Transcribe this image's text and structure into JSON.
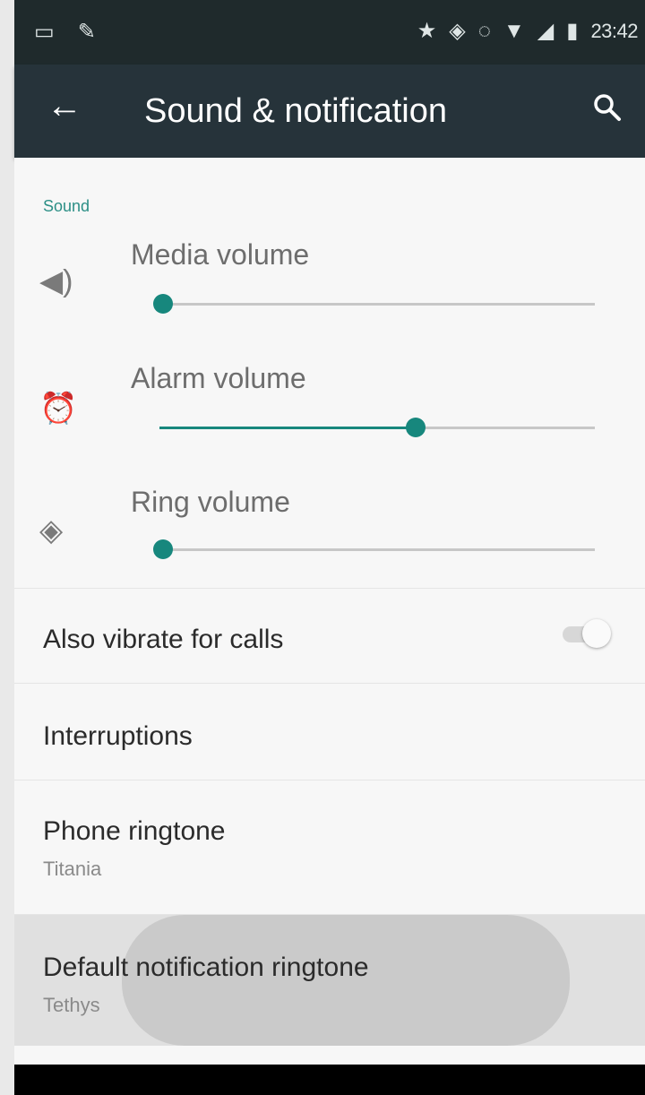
{
  "status_bar": {
    "left_icons": [
      "image-icon",
      "pen-icon"
    ],
    "right_icons": [
      "star-icon",
      "vibrate-icon",
      "alarm-icon",
      "wifi-icon",
      "signal-icon",
      "battery-icon"
    ],
    "time": "23:42"
  },
  "app_bar": {
    "title": "Sound & notification",
    "back_icon": "arrow-back-icon",
    "search_icon": "search-icon"
  },
  "colors": {
    "accent": "#17877d",
    "appbar": "#26333a",
    "statusbar": "#1f2a2c"
  },
  "section": {
    "header": "Sound"
  },
  "volumes": [
    {
      "label": "Media volume",
      "icon": "speaker-icon",
      "level": 0.0
    },
    {
      "label": "Alarm volume",
      "icon": "alarm-clock-icon",
      "level": 0.58
    },
    {
      "label": "Ring volume",
      "icon": "vibrate-icon",
      "level": 0.0
    }
  ],
  "settings": {
    "vibrate": {
      "label": "Also vibrate for calls",
      "enabled": false
    },
    "interruptions": {
      "label": "Interruptions"
    },
    "phone_ringtone": {
      "label": "Phone ringtone",
      "value": "Titania"
    },
    "notification_ringtone": {
      "label": "Default notification ringtone",
      "value": "Tethys"
    }
  }
}
